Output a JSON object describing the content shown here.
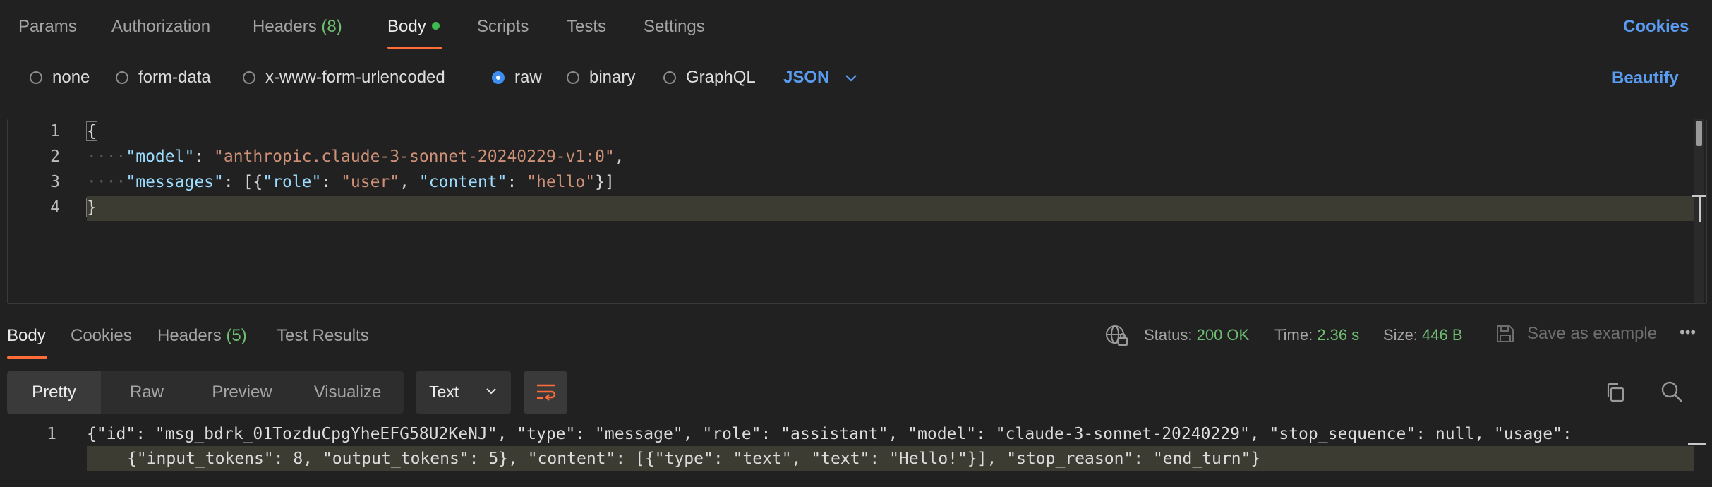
{
  "request_tabs": {
    "params": "Params",
    "authorization": "Authorization",
    "headers": "Headers",
    "headers_count": "(8)",
    "body": "Body",
    "scripts": "Scripts",
    "tests": "Tests",
    "settings": "Settings",
    "cookies": "Cookies"
  },
  "body_types": {
    "none": "none",
    "form_data": "form-data",
    "urlencoded": "x-www-form-urlencoded",
    "raw": "raw",
    "binary": "binary",
    "graphql": "GraphQL",
    "selected": "raw",
    "language": "JSON",
    "beautify": "Beautify"
  },
  "editor": {
    "line_numbers": [
      "1",
      "2",
      "3",
      "4"
    ],
    "line1": "{",
    "line2_ws": "····",
    "line2_key": "\"model\"",
    "line2_colon": ": ",
    "line2_val": "\"anthropic.claude-3-sonnet-20240229-v1:0\"",
    "line2_end": ",",
    "line3_ws": "····",
    "line3_key": "\"messages\"",
    "line3_a": ": [{",
    "line3_k1": "\"role\"",
    "line3_b": ": ",
    "line3_v1": "\"user\"",
    "line3_c": ", ",
    "line3_k2": "\"content\"",
    "line3_d": ": ",
    "line3_v2": "\"hello\"",
    "line3_e": "}]",
    "line4": "}"
  },
  "response_tabs": {
    "body": "Body",
    "cookies": "Cookies",
    "headers": "Headers",
    "headers_count": "(5)",
    "test_results": "Test Results"
  },
  "response_status": {
    "status_label": "Status:",
    "status_value": "200 OK",
    "time_label": "Time:",
    "time_value": "2.36 s",
    "size_label": "Size:",
    "size_value": "446 B",
    "save_example": "Save as example",
    "more": "•••"
  },
  "response_view": {
    "pretty": "Pretty",
    "raw": "Raw",
    "preview": "Preview",
    "visualize": "Visualize",
    "format": "Text"
  },
  "response_body": {
    "line_number": "1",
    "line1": "{\"id\": \"msg_bdrk_01TozduCpgYheEFG58U2KeNJ\", \"type\": \"message\", \"role\": \"assistant\", \"model\": \"claude-3-sonnet-20240229\", \"stop_sequence\": null, \"usage\":",
    "line2": "{\"input_tokens\": 8, \"output_tokens\": 5}, \"content\": [{\"type\": \"text\", \"text\": \"Hello!\"}], \"stop_reason\": \"end_turn\"}"
  },
  "colors": {
    "accent_orange": "#ff6c37",
    "link_blue": "#5a9cf0",
    "status_green": "#6fbf73",
    "background": "#212121"
  }
}
